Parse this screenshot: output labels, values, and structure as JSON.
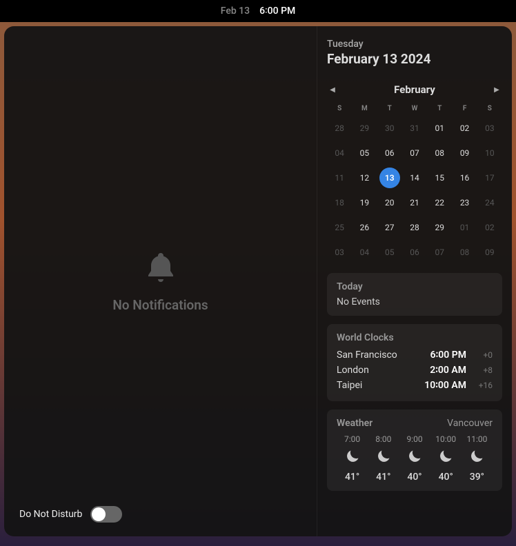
{
  "topbar": {
    "date": "Feb 13",
    "time": "6∶00 PM"
  },
  "notifications": {
    "empty_text": "No Notifications"
  },
  "dnd": {
    "label": "Do Not Disturb",
    "enabled": false
  },
  "date_header": {
    "weekday": "Tuesday",
    "fulldate": "February 13 2024"
  },
  "calendar": {
    "month_label": "February",
    "weekdays": [
      "S",
      "M",
      "T",
      "W",
      "T",
      "F",
      "S"
    ],
    "today": "13",
    "rows": [
      [
        {
          "d": "28",
          "dim": true
        },
        {
          "d": "29",
          "dim": true
        },
        {
          "d": "30",
          "dim": true
        },
        {
          "d": "31",
          "dim": true
        },
        {
          "d": "01"
        },
        {
          "d": "02"
        },
        {
          "d": "03",
          "dim": true
        }
      ],
      [
        {
          "d": "04",
          "dim": true
        },
        {
          "d": "05"
        },
        {
          "d": "06"
        },
        {
          "d": "07"
        },
        {
          "d": "08"
        },
        {
          "d": "09"
        },
        {
          "d": "10",
          "dim": true
        }
      ],
      [
        {
          "d": "11",
          "dim": true
        },
        {
          "d": "12"
        },
        {
          "d": "13",
          "today": true
        },
        {
          "d": "14"
        },
        {
          "d": "15"
        },
        {
          "d": "16"
        },
        {
          "d": "17",
          "dim": true
        }
      ],
      [
        {
          "d": "18",
          "dim": true
        },
        {
          "d": "19"
        },
        {
          "d": "20"
        },
        {
          "d": "21"
        },
        {
          "d": "22"
        },
        {
          "d": "23"
        },
        {
          "d": "24",
          "dim": true
        }
      ],
      [
        {
          "d": "25",
          "dim": true
        },
        {
          "d": "26"
        },
        {
          "d": "27"
        },
        {
          "d": "28"
        },
        {
          "d": "29"
        },
        {
          "d": "01",
          "dim": true
        },
        {
          "d": "02",
          "dim": true
        }
      ],
      [
        {
          "d": "03",
          "dim": true
        },
        {
          "d": "04",
          "dim": true
        },
        {
          "d": "05",
          "dim": true
        },
        {
          "d": "06",
          "dim": true
        },
        {
          "d": "07",
          "dim": true
        },
        {
          "d": "08",
          "dim": true
        },
        {
          "d": "09",
          "dim": true
        }
      ]
    ]
  },
  "events": {
    "title": "Today",
    "empty": "No Events"
  },
  "world_clocks": {
    "title": "World Clocks",
    "items": [
      {
        "city": "San Francisco",
        "time": "6∶00 PM",
        "offset": "+0"
      },
      {
        "city": "London",
        "time": "2∶00 AM",
        "offset": "+8"
      },
      {
        "city": "Taipei",
        "time": "10∶00 AM",
        "offset": "+16"
      }
    ]
  },
  "weather": {
    "title": "Weather",
    "location": "Vancouver",
    "hours": [
      {
        "hour": "7:00",
        "icon": "moon",
        "temp": "41°"
      },
      {
        "hour": "8:00",
        "icon": "moon",
        "temp": "41°"
      },
      {
        "hour": "9:00",
        "icon": "moon",
        "temp": "40°"
      },
      {
        "hour": "10:00",
        "icon": "moon",
        "temp": "40°"
      },
      {
        "hour": "11:00",
        "icon": "moon",
        "temp": "39°"
      }
    ]
  }
}
